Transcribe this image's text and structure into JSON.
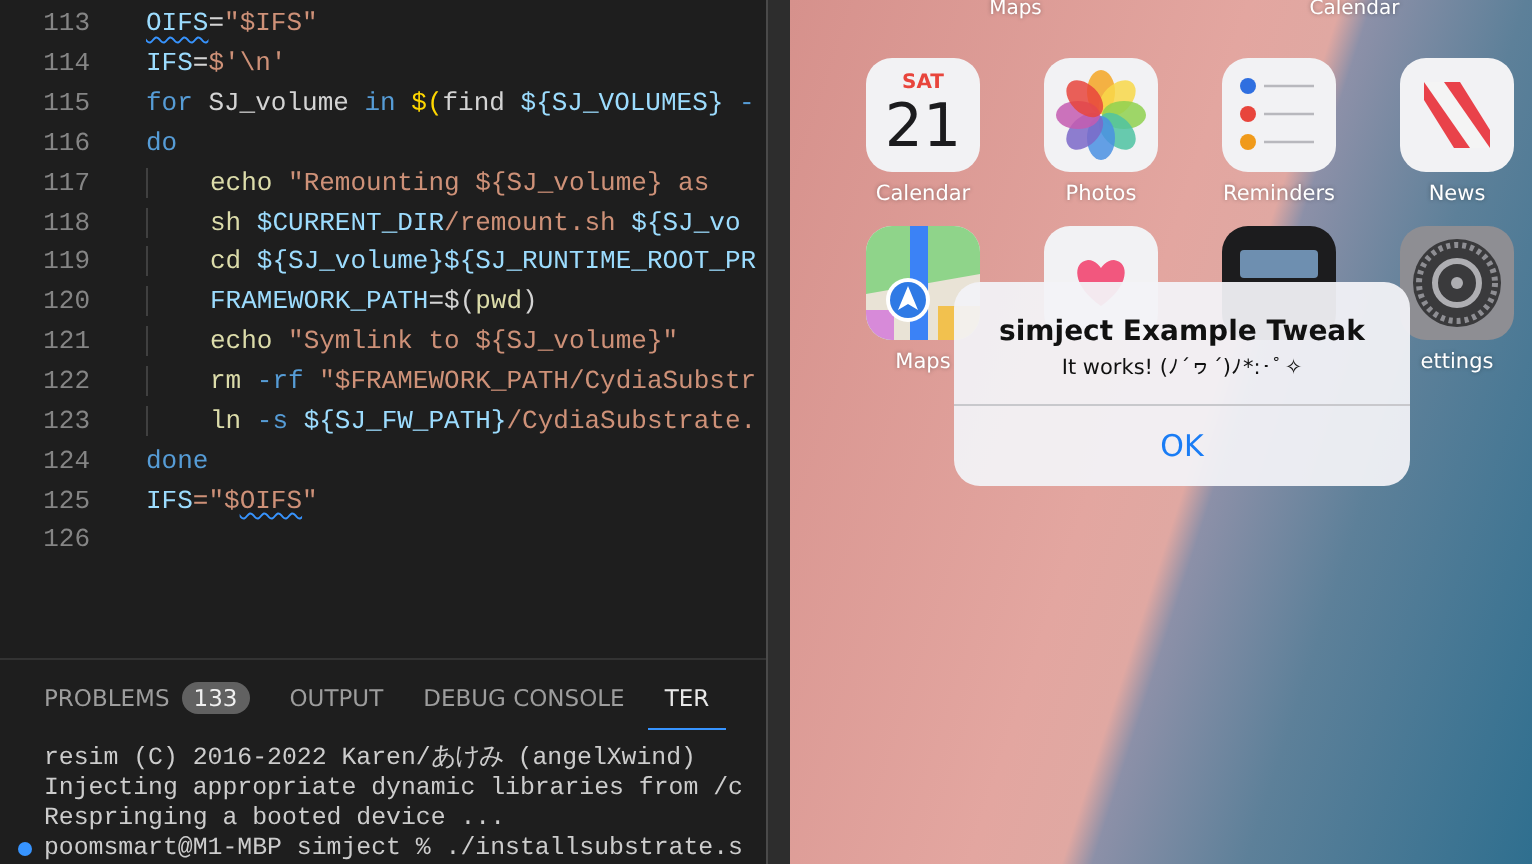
{
  "editor": {
    "lines": [
      {
        "number": "113",
        "tokens": [
          {
            "text": "OIFS",
            "kind": "var-warn"
          },
          {
            "text": "=",
            "kind": "plain"
          },
          {
            "text": "\"$IFS\"",
            "kind": "str"
          }
        ]
      },
      {
        "number": "114",
        "tokens": [
          {
            "text": "IFS",
            "kind": "var"
          },
          {
            "text": "=",
            "kind": "plain"
          },
          {
            "text": "$'\\n'",
            "kind": "str"
          }
        ]
      },
      {
        "number": "115",
        "tokens": [
          {
            "text": "for",
            "kind": "kw"
          },
          {
            "text": " SJ_volume ",
            "kind": "plain"
          },
          {
            "text": "in",
            "kind": "kw"
          },
          {
            "text": " $(",
            "kind": "punc"
          },
          {
            "text": "find ",
            "kind": "plain"
          },
          {
            "text": "${SJ_VOLUMES}",
            "kind": "var"
          },
          {
            "text": " -",
            "kind": "op"
          }
        ]
      },
      {
        "number": "116",
        "tokens": [
          {
            "text": "do",
            "kind": "kw"
          }
        ],
        "children": [
          {
            "number": "117",
            "tokens": [
              {
                "text": "echo",
                "kind": "fn"
              },
              {
                "text": " \"Remounting ${SJ_volume} as",
                "kind": "str"
              }
            ]
          },
          {
            "number": "118",
            "tokens": [
              {
                "text": "sh",
                "kind": "fn"
              },
              {
                "text": " $CURRENT_DIR",
                "kind": "var"
              },
              {
                "text": "/remount.sh ",
                "kind": "str"
              },
              {
                "text": "${SJ_vo",
                "kind": "var"
              }
            ]
          },
          {
            "number": "119",
            "tokens": [
              {
                "text": "cd",
                "kind": "fn"
              },
              {
                "text": " ${SJ_volume}${SJ_RUNTIME_ROOT_PR",
                "kind": "var"
              }
            ]
          },
          {
            "number": "120",
            "tokens": [
              {
                "text": "FRAMEWORK_PATH",
                "kind": "var"
              },
              {
                "text": "=$(",
                "kind": "plain"
              },
              {
                "text": "pwd",
                "kind": "fn"
              },
              {
                "text": ")",
                "kind": "plain"
              }
            ]
          },
          {
            "number": "121",
            "tokens": [
              {
                "text": "echo",
                "kind": "fn"
              },
              {
                "text": " \"Symlink to ${SJ_volume}\"",
                "kind": "str"
              }
            ]
          },
          {
            "number": "122",
            "tokens": [
              {
                "text": "rm",
                "kind": "fn"
              },
              {
                "text": " -rf",
                "kind": "op"
              },
              {
                "text": " \"$FRAMEWORK_PATH/CydiaSubstr",
                "kind": "str"
              }
            ]
          },
          {
            "number": "123",
            "tokens": [
              {
                "text": "ln",
                "kind": "fn"
              },
              {
                "text": " -s",
                "kind": "op"
              },
              {
                "text": " ${SJ_FW_PATH}",
                "kind": "var"
              },
              {
                "text": "/CydiaSubstrate.",
                "kind": "str"
              }
            ]
          }
        ]
      },
      {
        "number": "124",
        "tokens": [
          {
            "text": "done",
            "kind": "kw"
          }
        ]
      },
      {
        "number": "125",
        "tokens": [
          {
            "text": "IFS",
            "kind": "var"
          },
          {
            "text": "=\"$",
            "kind": "str"
          },
          {
            "text": "OIFS",
            "kind": "str-warn"
          },
          {
            "text": "\"",
            "kind": "str"
          }
        ]
      },
      {
        "number": "126"
      }
    ]
  },
  "panel": {
    "tabs": [
      {
        "label": "PROBLEMS",
        "badge": "133",
        "selected": false
      },
      {
        "label": "OUTPUT",
        "selected": false
      },
      {
        "label": "DEBUG CONSOLE",
        "selected": false
      },
      {
        "label": "TER",
        "selected": true
      }
    ],
    "terminal_lines": [
      {
        "kind": "output",
        "text": "resim (C) 2016-2022 Karen/あけみ (angelXwind)"
      },
      {
        "kind": "output",
        "text": "Injecting appropriate dynamic libraries from /c"
      },
      {
        "kind": "output",
        "text": "Respringing a booted device ..."
      },
      {
        "kind": "prompt",
        "text": "poomsmart@M1-MBP simject % ./installsubstrate.s"
      }
    ]
  },
  "simulator": {
    "top_labels": [
      "Maps",
      "Calendar"
    ],
    "apps": [
      {
        "kind": "calendar",
        "label": "Calendar",
        "weekday": "SAT",
        "day": "21"
      },
      {
        "kind": "photos",
        "label": "Photos"
      },
      {
        "kind": "reminders",
        "label": "Reminders"
      },
      {
        "kind": "news",
        "label": "News"
      },
      {
        "kind": "maps",
        "label": "Maps"
      },
      {
        "kind": "health"
      },
      {
        "kind": "wallet"
      },
      {
        "kind": "settings",
        "label": "ettings"
      }
    ],
    "alert": {
      "title": "simject Example Tweak",
      "message": "It works! (ﾉ´ヮ´)ﾉ*:･ﾟ✧",
      "buttons": [
        "OK"
      ]
    }
  }
}
